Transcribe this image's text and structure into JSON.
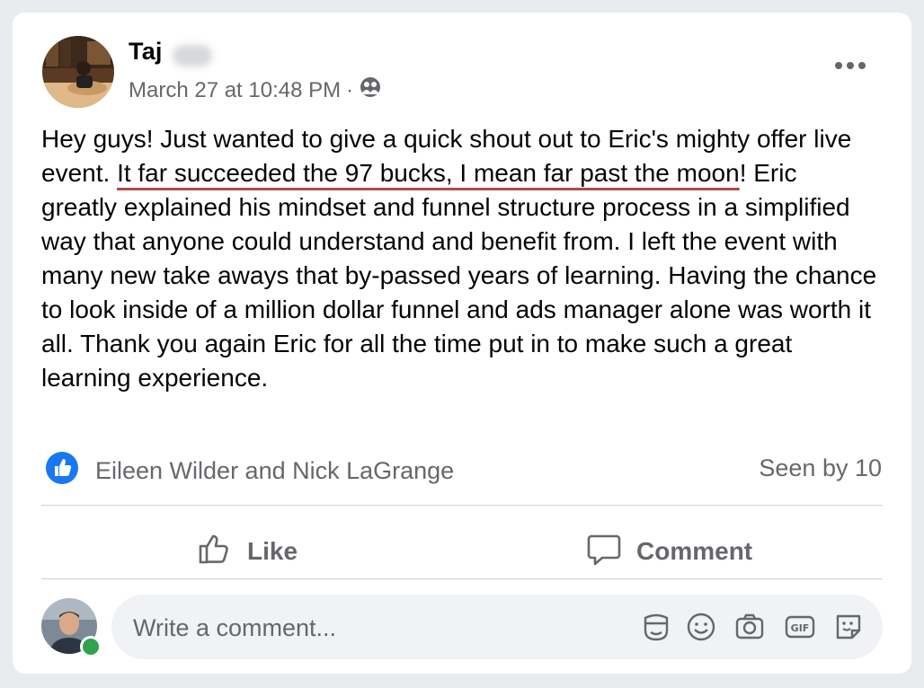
{
  "post": {
    "author": "Taj",
    "timestamp": "March 27 at 10:48 PM",
    "separator": "·",
    "audience_icon": "group-audience-icon",
    "text_before": "Hey guys! Just wanted to give a quick shout out to Eric's mighty offer live event. ",
    "text_highlight": "It far succeeded the 97 bucks, I mean far past the moon",
    "text_after": "! Eric greatly explained his mindset and funnel structure process in a simplified way that anyone could understand and benefit from. I left the event with many new take aways that by-passed years of learning. Having the chance to look inside of a million dollar funnel and ads manager alone was worth it all. Thank you again Eric for all the time put in to make such a great learning experience."
  },
  "reactions": {
    "names": "Eileen Wilder and Nick LaGrange",
    "seen": "Seen by 10",
    "icon": "like-reaction-icon"
  },
  "actions": {
    "like": "Like",
    "comment": "Comment"
  },
  "composer": {
    "placeholder": "Write a comment..."
  },
  "colors": {
    "like_blue": "#1877f2",
    "secondary_text": "#65676b",
    "highlight_underline": "#b04a48",
    "online_green": "#31a24c"
  }
}
